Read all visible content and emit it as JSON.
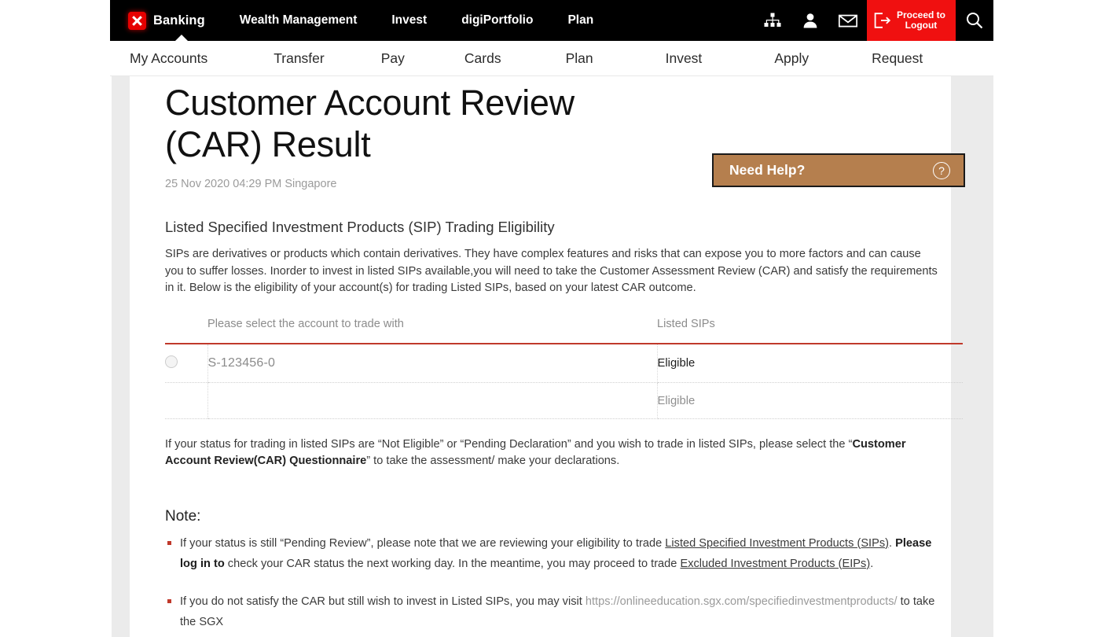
{
  "topnav": {
    "brand_label": "Banking",
    "logo_icon": "x-logo-icon",
    "items": [
      {
        "label": "Wealth Management"
      },
      {
        "label": "Invest"
      },
      {
        "label": "digiPortfolio"
      },
      {
        "label": "Plan"
      }
    ],
    "icons": [
      {
        "name": "sitemap-icon"
      },
      {
        "name": "person-icon"
      },
      {
        "name": "envelope-icon"
      },
      {
        "name": "search-icon"
      }
    ],
    "logout": {
      "label": "Proceed to\nLogout",
      "icon": "logout-icon",
      "color": "#f01010"
    }
  },
  "subnav": {
    "items": [
      {
        "label": "My Accounts"
      },
      {
        "label": "Transfer"
      },
      {
        "label": "Pay"
      },
      {
        "label": "Cards"
      },
      {
        "label": "Plan"
      },
      {
        "label": "Invest"
      },
      {
        "label": "Apply"
      },
      {
        "label": "Request"
      }
    ]
  },
  "need_help": {
    "label": "Need Help?",
    "icon": "question-circle-icon",
    "color": "#b57f4e"
  },
  "page": {
    "title": "Customer Account Review (CAR) Result",
    "timestamp": "25 Nov 2020 04:29 PM Singapore",
    "section_title": "Listed Specified Investment Products (SIP) Trading Eligibility",
    "intro": "SIPs are derivatives or products which contain derivatives. They have complex features and risks that can expose you to more factors and can cause you to suffer losses. Inorder to invest in listed SIPs available,you will need to take the Customer Assessment Review (CAR) and satisfy the requirements in it. Below is the eligibility of your account(s) for trading Listed SIPs, based on your latest CAR outcome."
  },
  "table": {
    "headers": {
      "radio": "",
      "account": "Please select the account to trade with",
      "sips": "Listed SIPs"
    },
    "rows": [
      {
        "selected": false,
        "account": "S-123456-0",
        "sips": "Eligible",
        "emphasis": "strong"
      },
      {
        "selected": false,
        "account": "",
        "sips": "Eligible",
        "emphasis": "muted"
      }
    ],
    "rule_color": "#c0392b"
  },
  "after_table": {
    "part1": "If your status for trading in listed SIPs are “Not Eligible” or “Pending Declaration” and you wish to trade in listed SIPs, please select the “",
    "bold": "Customer Account Review(CAR) Questionnaire",
    "part2": "” to take the assessment/ make your declarations."
  },
  "note": {
    "title": "Note:",
    "items": [
      {
        "part1": "If your status is still “Pending Review”, please note that we are reviewing your eligibility to trade ",
        "link1": "Listed Specified Investment Products (SIPs)",
        "part2": ". ",
        "bold": "Please log in to",
        "part3": " check your CAR status the next working day. In the meantime, you may proceed to trade ",
        "link2": "Excluded Investment Products (EIPs)",
        "part4": "."
      },
      {
        "part1": "If you do not satisfy the CAR but still wish to invest in Listed SIPs, you may visit ",
        "url": "https://onlineeducation.sgx.com/specifiedinvestmentproducts/",
        "part2": " to take the SGX"
      }
    ]
  }
}
